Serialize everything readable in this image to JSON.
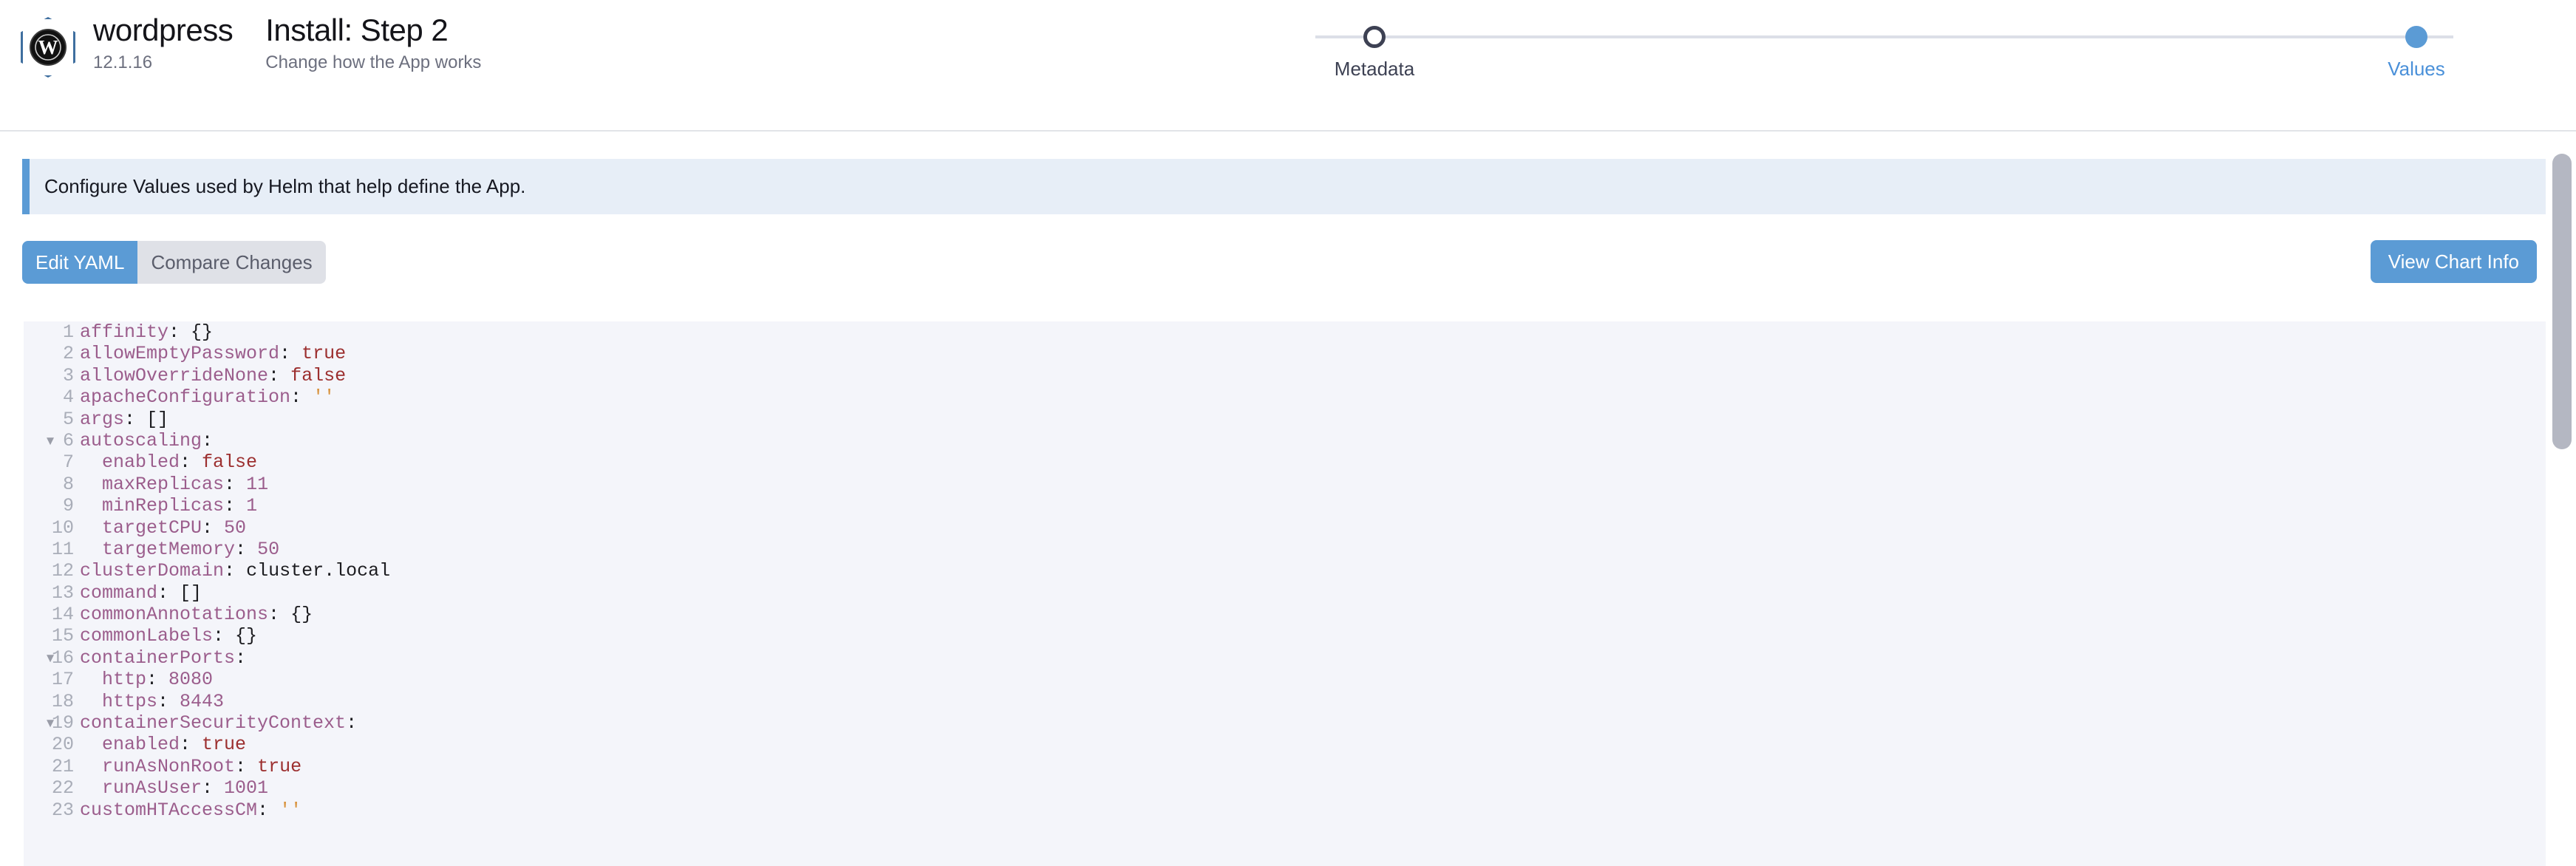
{
  "header": {
    "app_name": "wordpress",
    "app_version": "12.1.16",
    "step_title": "Install: Step 2",
    "step_subtitle": "Change how the App works",
    "logo_icon": "wordpress-logo-icon"
  },
  "stepper": {
    "steps": [
      {
        "label": "Metadata",
        "state": "inactive"
      },
      {
        "label": "Values",
        "state": "active"
      }
    ],
    "active_color": "#4a90d9",
    "inactive_color": "#3d4153",
    "track_color": "#dcdfe7"
  },
  "banner": {
    "text": "Configure Values used by Helm that help define the App.",
    "accent_color": "#5b9bd5",
    "background_color": "#e7eef7"
  },
  "toolbar": {
    "tabs": [
      {
        "label": "Edit YAML",
        "state": "active"
      },
      {
        "label": "Compare Changes",
        "state": "idle"
      }
    ],
    "chart_info_label": "View Chart Info",
    "primary_color": "#5b9bd5"
  },
  "editor": {
    "language": "yaml",
    "background_color": "#f4f5fa",
    "lines": [
      {
        "n": 1,
        "fold": false,
        "tokens": [
          {
            "t": "affinity",
            "c": "k"
          },
          {
            "t": ": ",
            "c": "p"
          },
          {
            "t": "{}",
            "c": "p"
          }
        ]
      },
      {
        "n": 2,
        "fold": false,
        "tokens": [
          {
            "t": "allowEmptyPassword",
            "c": "k"
          },
          {
            "t": ": ",
            "c": "p"
          },
          {
            "t": "true",
            "c": "b"
          }
        ]
      },
      {
        "n": 3,
        "fold": false,
        "tokens": [
          {
            "t": "allowOverrideNone",
            "c": "k"
          },
          {
            "t": ": ",
            "c": "p"
          },
          {
            "t": "false",
            "c": "b"
          }
        ]
      },
      {
        "n": 4,
        "fold": false,
        "tokens": [
          {
            "t": "apacheConfiguration",
            "c": "k"
          },
          {
            "t": ": ",
            "c": "p"
          },
          {
            "t": "''",
            "c": "s"
          }
        ]
      },
      {
        "n": 5,
        "fold": false,
        "tokens": [
          {
            "t": "args",
            "c": "k"
          },
          {
            "t": ": ",
            "c": "p"
          },
          {
            "t": "[]",
            "c": "p"
          }
        ]
      },
      {
        "n": 6,
        "fold": true,
        "tokens": [
          {
            "t": "autoscaling",
            "c": "k"
          },
          {
            "t": ":",
            "c": "p"
          }
        ]
      },
      {
        "n": 7,
        "fold": false,
        "tokens": [
          {
            "t": "  enabled",
            "c": "k"
          },
          {
            "t": ": ",
            "c": "p"
          },
          {
            "t": "false",
            "c": "b"
          }
        ]
      },
      {
        "n": 8,
        "fold": false,
        "tokens": [
          {
            "t": "  maxReplicas",
            "c": "k"
          },
          {
            "t": ": ",
            "c": "p"
          },
          {
            "t": "11",
            "c": "num"
          }
        ]
      },
      {
        "n": 9,
        "fold": false,
        "tokens": [
          {
            "t": "  minReplicas",
            "c": "k"
          },
          {
            "t": ": ",
            "c": "p"
          },
          {
            "t": "1",
            "c": "num"
          }
        ]
      },
      {
        "n": 10,
        "fold": false,
        "tokens": [
          {
            "t": "  targetCPU",
            "c": "k"
          },
          {
            "t": ": ",
            "c": "p"
          },
          {
            "t": "50",
            "c": "num"
          }
        ]
      },
      {
        "n": 11,
        "fold": false,
        "tokens": [
          {
            "t": "  targetMemory",
            "c": "k"
          },
          {
            "t": ": ",
            "c": "p"
          },
          {
            "t": "50",
            "c": "num"
          }
        ]
      },
      {
        "n": 12,
        "fold": false,
        "tokens": [
          {
            "t": "clusterDomain",
            "c": "k"
          },
          {
            "t": ": ",
            "c": "p"
          },
          {
            "t": "cluster.local",
            "c": "p"
          }
        ]
      },
      {
        "n": 13,
        "fold": false,
        "tokens": [
          {
            "t": "command",
            "c": "k"
          },
          {
            "t": ": ",
            "c": "p"
          },
          {
            "t": "[]",
            "c": "p"
          }
        ]
      },
      {
        "n": 14,
        "fold": false,
        "tokens": [
          {
            "t": "commonAnnotations",
            "c": "k"
          },
          {
            "t": ": ",
            "c": "p"
          },
          {
            "t": "{}",
            "c": "p"
          }
        ]
      },
      {
        "n": 15,
        "fold": false,
        "tokens": [
          {
            "t": "commonLabels",
            "c": "k"
          },
          {
            "t": ": ",
            "c": "p"
          },
          {
            "t": "{}",
            "c": "p"
          }
        ]
      },
      {
        "n": 16,
        "fold": true,
        "tokens": [
          {
            "t": "containerPorts",
            "c": "k"
          },
          {
            "t": ":",
            "c": "p"
          }
        ]
      },
      {
        "n": 17,
        "fold": false,
        "tokens": [
          {
            "t": "  http",
            "c": "k"
          },
          {
            "t": ": ",
            "c": "p"
          },
          {
            "t": "8080",
            "c": "num"
          }
        ]
      },
      {
        "n": 18,
        "fold": false,
        "tokens": [
          {
            "t": "  https",
            "c": "k"
          },
          {
            "t": ": ",
            "c": "p"
          },
          {
            "t": "8443",
            "c": "num"
          }
        ]
      },
      {
        "n": 19,
        "fold": true,
        "tokens": [
          {
            "t": "containerSecurityContext",
            "c": "k"
          },
          {
            "t": ":",
            "c": "p"
          }
        ]
      },
      {
        "n": 20,
        "fold": false,
        "tokens": [
          {
            "t": "  enabled",
            "c": "k"
          },
          {
            "t": ": ",
            "c": "p"
          },
          {
            "t": "true",
            "c": "b"
          }
        ]
      },
      {
        "n": 21,
        "fold": false,
        "tokens": [
          {
            "t": "  runAsNonRoot",
            "c": "k"
          },
          {
            "t": ": ",
            "c": "p"
          },
          {
            "t": "true",
            "c": "b"
          }
        ]
      },
      {
        "n": 22,
        "fold": false,
        "tokens": [
          {
            "t": "  runAsUser",
            "c": "k"
          },
          {
            "t": ": ",
            "c": "p"
          },
          {
            "t": "1001",
            "c": "num"
          }
        ]
      },
      {
        "n": 23,
        "fold": false,
        "tokens": [
          {
            "t": "customHTAccessCM",
            "c": "k"
          },
          {
            "t": ": ",
            "c": "p"
          },
          {
            "t": "''",
            "c": "s"
          }
        ]
      }
    ]
  },
  "scrollbar": {
    "orientation": "vertical",
    "thumb_color": "#b4b7c2"
  }
}
